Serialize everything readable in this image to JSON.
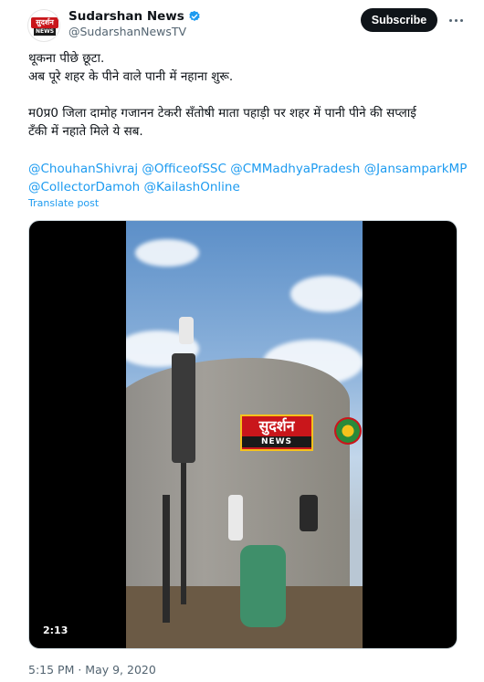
{
  "author": {
    "display_name": "Sudarshan News",
    "handle": "@SudarshanNewsTV",
    "avatar_text_top": "सुदर्शन",
    "avatar_text_bottom": "NEWS"
  },
  "header": {
    "subscribe_label": "Subscribe",
    "more_icon": "more-horizontal-icon"
  },
  "tweet": {
    "lines": [
      "थूकना पीछे छूटा.",
      "अब पूरे शहर के पीने वाले पानी में नहाना शुरू.",
      "म0प्र0 जिला दामोह गजानन टेकरी सँतोषी माता पहाड़ी पर शहर में पानी पीने की सप्लाई",
      "टँकी में नहाते मिले ये सब."
    ],
    "mentions": [
      "@ChouhanShivraj",
      "@OfficeofSSC",
      "@CMMadhyaPradesh",
      "@JansamparkMP",
      "@CollectorDamoh",
      "@KailashOnline"
    ],
    "translate_label": "Translate post"
  },
  "media": {
    "duration": "2:13",
    "watermark_text": "सुदर्शन",
    "watermark_sub": "NEWS"
  },
  "footer": {
    "timestamp": "5:15 PM · May 9, 2020"
  },
  "colors": {
    "link": "#1d9bf0",
    "text": "#0f1419",
    "secondary": "#536471",
    "brand_red": "#c9161b"
  }
}
